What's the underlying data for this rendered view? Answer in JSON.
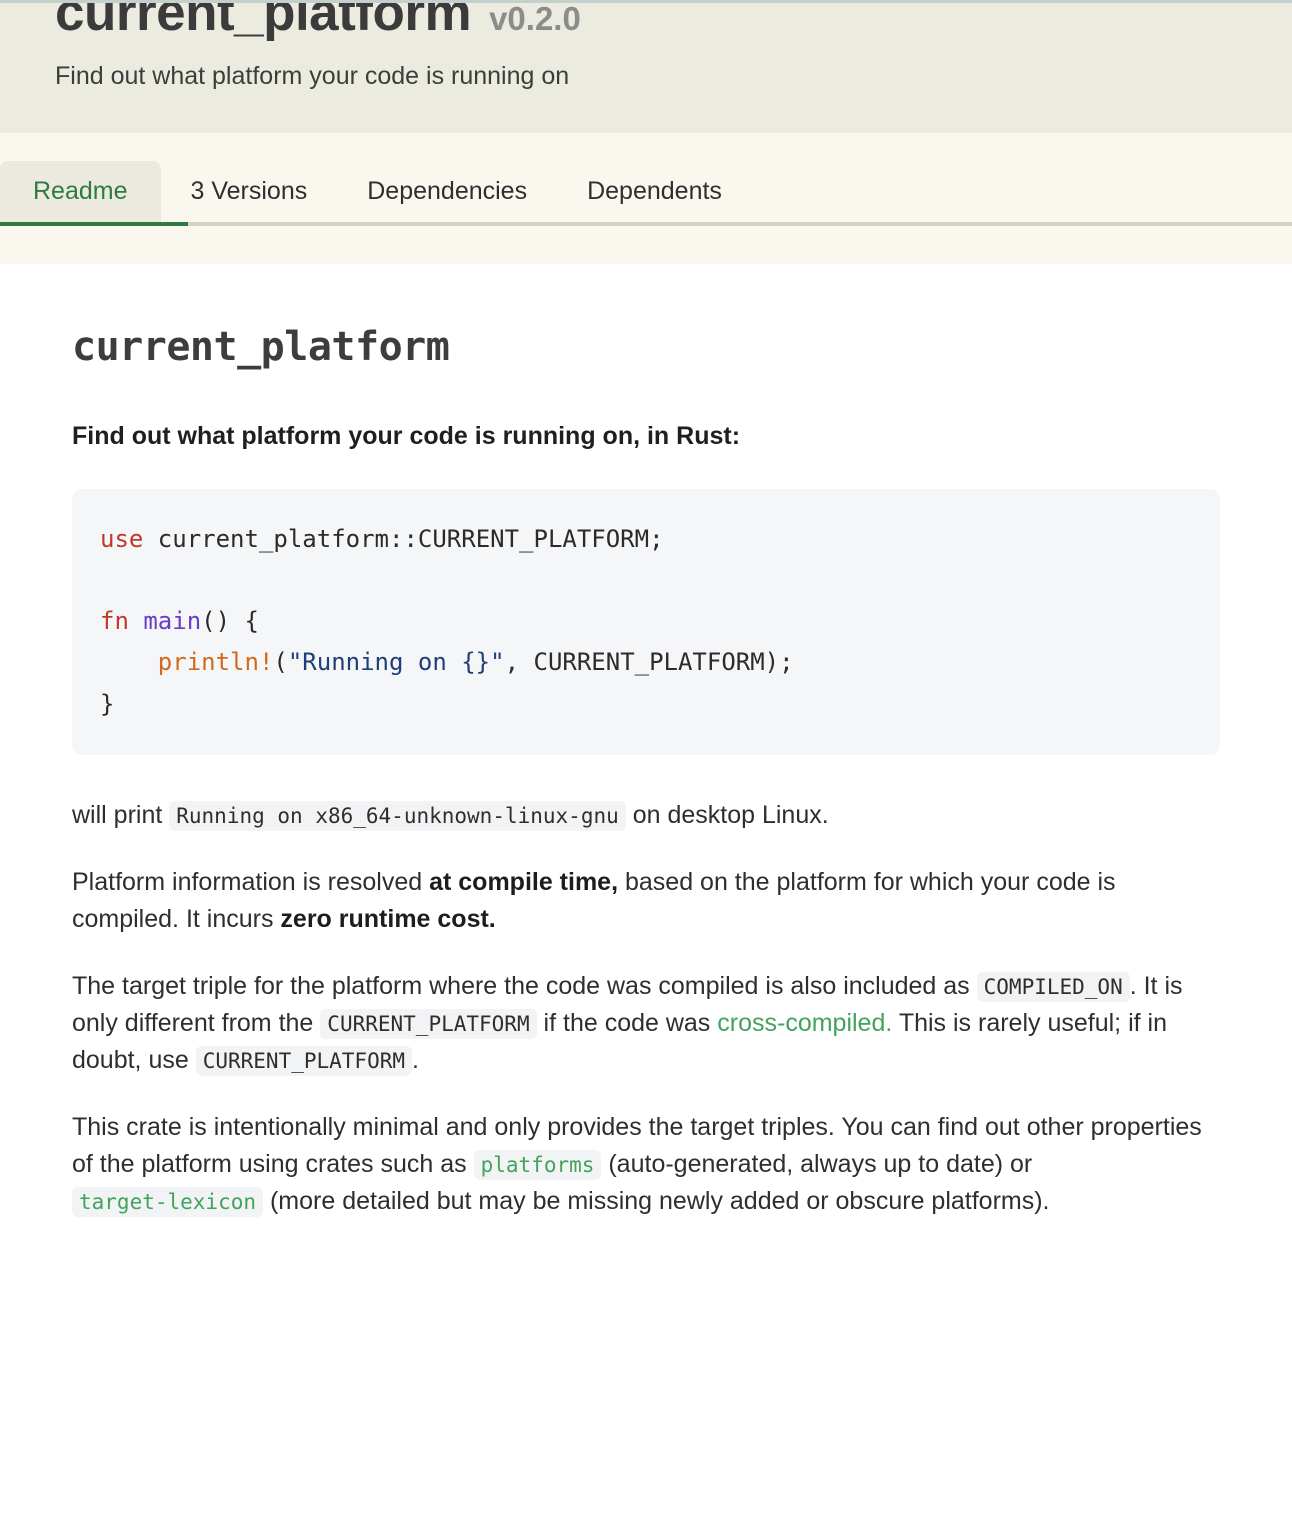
{
  "header": {
    "crate_name": "current_platform",
    "version": "v0.2.0",
    "description": "Find out what platform your code is running on"
  },
  "tabs": [
    {
      "label": "Readme",
      "active": true
    },
    {
      "label": "3 Versions",
      "active": false
    },
    {
      "label": "Dependencies",
      "active": false
    },
    {
      "label": "Dependents",
      "active": false
    }
  ],
  "readme": {
    "heading": "current_platform",
    "lead": "Find out what platform your code is running on, in Rust:",
    "code_block": {
      "line1_kw": "use",
      "line1_rest": " current_platform::CURRENT_PLATFORM;",
      "line3_kw": "fn",
      "line3_fn": "main",
      "line3_rest": "() {",
      "line4_indent": "    ",
      "line4_mac": "println!",
      "line4_open": "(",
      "line4_str": "\"Running on {}\"",
      "line4_rest": ", CURRENT_PLATFORM);",
      "line5": "}"
    },
    "para_will_print": {
      "before": "will print",
      "code": "Running on x86_64-unknown-linux-gnu",
      "after": "on desktop Linux."
    },
    "para_compile_time": {
      "seg1": "Platform information is resolved ",
      "bold1": "at compile time,",
      "seg2": " based on the platform for which your code is compiled. It incurs ",
      "bold2": "zero runtime cost."
    },
    "para_target_triple": {
      "seg1": "The target triple for the platform where the code was compiled is also included as",
      "code1": "COMPILED_ON",
      "seg2": ". It is only different from the",
      "code2": "CURRENT_PLATFORM",
      "seg3": "if the code was",
      "link": "cross-compiled.",
      "seg4": "This is rarely useful; if in doubt, use",
      "code3": "CURRENT_PLATFORM",
      "seg5": "."
    },
    "para_minimal": {
      "seg1": "This crate is intentionally minimal and only provides the target triples. You can find out other properties of the platform using crates such as",
      "code1": "platforms",
      "seg2": "(auto-generated, always up to date) or",
      "code2": "target-lexicon",
      "seg3": "(more detailed but may be missing newly added or obscure platforms)."
    }
  },
  "colors": {
    "header_bg": "#ecebe0",
    "tabbar_bg": "#faf7ef",
    "accent_green": "#2c7a44",
    "link_green": "#43a25c",
    "code_bg": "#f5f6f8",
    "inline_code_bg": "#f2f3f5",
    "top_rule": "#c3d0cd"
  }
}
